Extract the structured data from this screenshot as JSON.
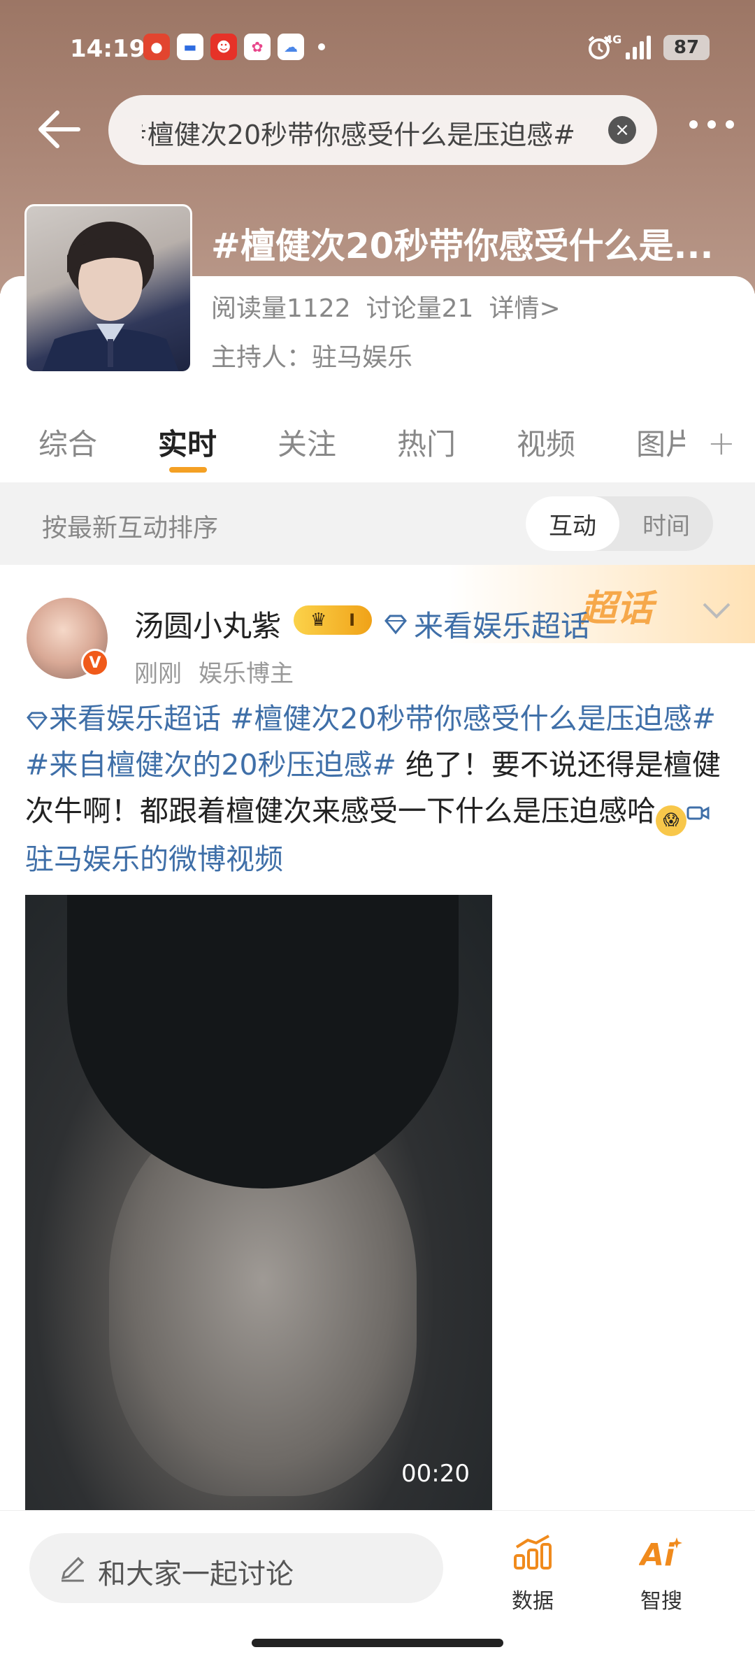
{
  "status_bar": {
    "time": "14:19",
    "network": "4G",
    "battery": "87"
  },
  "search": {
    "query": "#檀健次20秒带你感受什么是压迫感#"
  },
  "topic": {
    "title": "#檀健次20秒带你感受什么是...",
    "reads": "阅读量1122",
    "discussions": "讨论量21",
    "details": "详情>",
    "host": "主持人：驻马娱乐"
  },
  "tabs": [
    "综合",
    "实时",
    "关注",
    "热门",
    "视频",
    "图片"
  ],
  "sort": {
    "label": "按最新互动排序",
    "options": [
      "互动",
      "时间"
    ]
  },
  "post": {
    "banner": "超话",
    "username": "汤圆小丸紫",
    "vip_level": "I",
    "supertopic": "来看娱乐超话",
    "time": "刚刚",
    "user_type": "娱乐博主",
    "body_link1": "来看娱乐超话",
    "body_link2": "#檀健次20秒带你感受什么是压迫感#",
    "body_link3": "#来自檀健次的20秒压迫感#",
    "body_text": "绝了！要不说还得是檀健次牛啊！都跟着檀健次来感受一下什么是压迫感哈",
    "video_link": "驻马娱乐的微博视频",
    "video_duration": "00:20"
  },
  "bottom": {
    "comment_placeholder": "和大家一起讨论",
    "data_label": "数据",
    "ai_label": "智搜"
  }
}
